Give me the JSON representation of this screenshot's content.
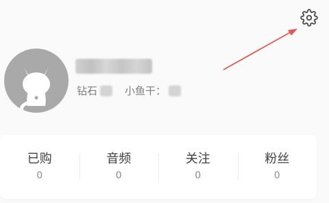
{
  "header": {
    "settings_icon": "gear-icon"
  },
  "annotation": {
    "arrow_color": "#e05a4e"
  },
  "profile": {
    "avatar_icon": "cat-avatar-icon",
    "username": "",
    "diamond_label": "钻石",
    "diamond_value": "",
    "fish_label": "小鱼干：",
    "fish_value": ""
  },
  "stats": [
    {
      "label": "已购",
      "count": "0"
    },
    {
      "label": "音频",
      "count": "0"
    },
    {
      "label": "关注",
      "count": "0"
    },
    {
      "label": "粉丝",
      "count": "0"
    }
  ],
  "colors": {
    "background": "#fafafa",
    "card": "#ffffff",
    "avatar": "#a9a9a9",
    "text_primary": "#3f3f3f",
    "text_secondary": "#8c8c8c"
  }
}
